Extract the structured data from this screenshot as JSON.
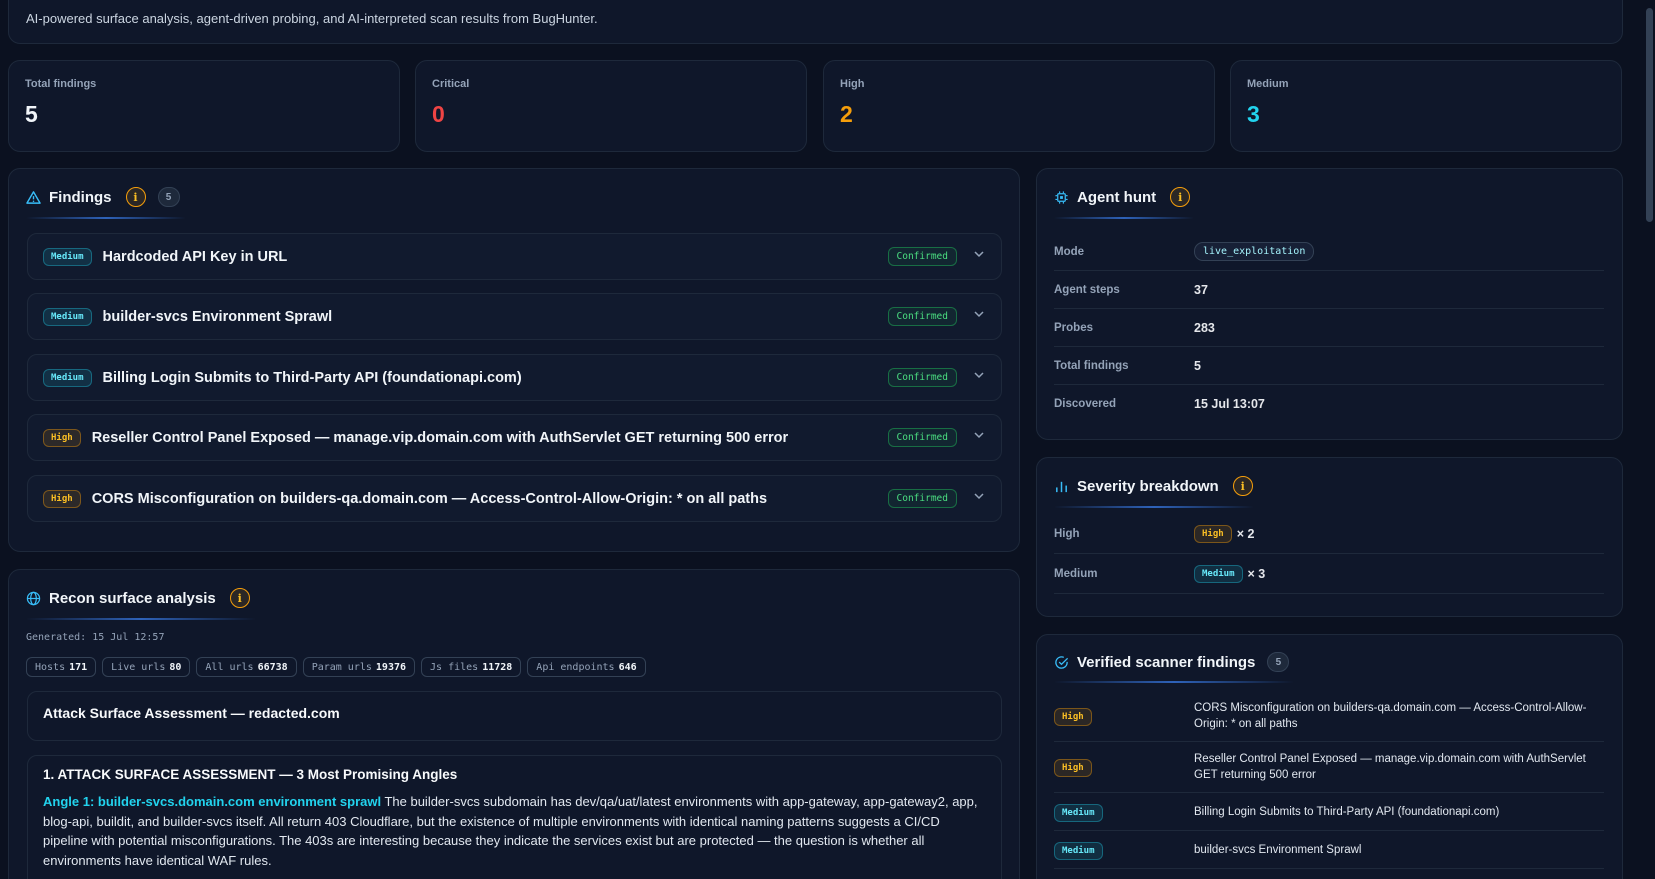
{
  "header": {
    "subtitle": "AI-powered surface analysis, agent-driven probing, and AI-interpreted scan results from BugHunter."
  },
  "stats": [
    {
      "label": "Total findings",
      "value": "5",
      "color": "#f1f5f9"
    },
    {
      "label": "Critical",
      "value": "0",
      "color": "#ef4444"
    },
    {
      "label": "High",
      "value": "2",
      "color": "#f59e0b"
    },
    {
      "label": "Medium",
      "value": "3",
      "color": "#22d3ee"
    }
  ],
  "findings": {
    "title": "Findings",
    "info_icon": "i",
    "count": "5",
    "items": [
      {
        "severity": "Medium",
        "title": "Hardcoded API Key in URL",
        "status": "Confirmed"
      },
      {
        "severity": "Medium",
        "title": "builder-svcs Environment Sprawl",
        "status": "Confirmed"
      },
      {
        "severity": "Medium",
        "title": "Billing Login Submits to Third-Party API (foundationapi.com)",
        "status": "Confirmed"
      },
      {
        "severity": "High",
        "title": "Reseller Control Panel Exposed — manage.vip.domain.com with AuthServlet GET returning 500 error",
        "status": "Confirmed"
      },
      {
        "severity": "High",
        "title": "CORS Misconfiguration on builders-qa.domain.com — Access-Control-Allow-Origin: * on all paths",
        "status": "Confirmed"
      }
    ]
  },
  "recon": {
    "title": "Recon surface analysis",
    "info_icon": "i",
    "generated": "Generated: 15 Jul 12:57",
    "chips": [
      {
        "label": "Hosts",
        "value": "171"
      },
      {
        "label": "Live urls",
        "value": "80"
      },
      {
        "label": "All urls",
        "value": "66738"
      },
      {
        "label": "Param urls",
        "value": "19376"
      },
      {
        "label": "Js files",
        "value": "11728"
      },
      {
        "label": "Api endpoints",
        "value": "646"
      }
    ],
    "assessment_title": "Attack Surface Assessment — redacted.com",
    "section_heading": "1. ATTACK SURFACE ASSESSMENT — 3 Most Promising Angles",
    "angle_label": "Angle 1: builder-svcs.domain.com environment sprawl",
    "angle_text": " The builder-svcs subdomain has dev/qa/uat/latest environments with app-gateway, app-gateway2, app, blog-api, buildit, and builder-svcs itself. All return 403 Cloudflare, but the existence of multiple environments with identical naming patterns suggests a CI/CD pipeline with potential misconfigurations. The 403s are interesting because they indicate the services exist but are protected — the question is whether all environments have identical WAF rules."
  },
  "agent": {
    "title": "Agent hunt",
    "info_icon": "i",
    "rows": [
      {
        "key": "Mode",
        "value": "live_exploitation"
      },
      {
        "key": "Agent steps",
        "value": "37"
      },
      {
        "key": "Probes",
        "value": "283"
      },
      {
        "key": "Total findings",
        "value": "5"
      },
      {
        "key": "Discovered",
        "value": "15 Jul 13:07"
      }
    ]
  },
  "severity_breakdown": {
    "title": "Severity breakdown",
    "info_icon": "i",
    "rows": [
      {
        "key": "High",
        "badge": "High",
        "count": "× 2"
      },
      {
        "key": "Medium",
        "badge": "Medium",
        "count": "× 3"
      }
    ]
  },
  "verified": {
    "title": "Verified scanner findings",
    "count": "5",
    "items": [
      {
        "severity": "High",
        "title": "CORS Misconfiguration on builders-qa.domain.com — Access-Control-Allow-Origin: * on all paths"
      },
      {
        "severity": "High",
        "title": "Reseller Control Panel Exposed — manage.vip.domain.com with AuthServlet GET returning 500 error"
      },
      {
        "severity": "Medium",
        "title": "Billing Login Submits to Third-Party API (foundationapi.com)"
      },
      {
        "severity": "Medium",
        "title": "builder-svcs Environment Sprawl"
      }
    ]
  }
}
